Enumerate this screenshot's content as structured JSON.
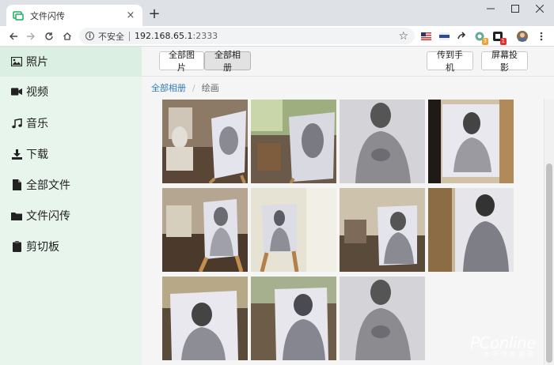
{
  "browser": {
    "tab_title": "文件闪传",
    "tab_close": "×",
    "new_tab": "+",
    "security_label": "不安全",
    "url_host": "192.168.65.1",
    "url_port": ":2333",
    "star": "☆",
    "ext_badges": [
      "3",
      "1"
    ]
  },
  "sidebar": {
    "items": [
      {
        "label": "照片",
        "icon": "image-icon"
      },
      {
        "label": "视频",
        "icon": "video-icon"
      },
      {
        "label": "音乐",
        "icon": "music-icon"
      },
      {
        "label": "下载",
        "icon": "download-icon"
      },
      {
        "label": "全部文件",
        "icon": "file-icon"
      },
      {
        "label": "文件闪传",
        "icon": "folder-icon"
      },
      {
        "label": "剪切板",
        "icon": "clipboard-icon"
      }
    ],
    "active_index": 0
  },
  "toolbar": {
    "all_photos": "全部图片",
    "all_albums": "全部相册",
    "send_to_phone": "传到手机",
    "screen_cast": "屏幕投影"
  },
  "breadcrumb": {
    "root": "全部相册",
    "separator": "/",
    "current": "绘画"
  },
  "watermark": {
    "main": "PConline",
    "sub": "太平洋电脑网"
  },
  "colors": {
    "sidebar_bg": "#e8f5ed",
    "sidebar_active": "#dcefe3",
    "link": "#337ab7",
    "favicon": "#1aad5a"
  }
}
